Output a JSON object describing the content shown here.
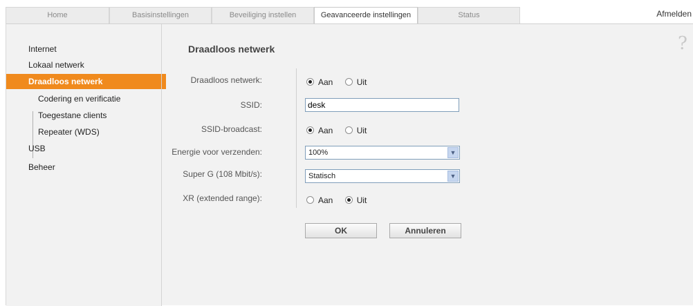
{
  "tabs": [
    {
      "label": "Home",
      "active": false
    },
    {
      "label": "Basisinstellingen",
      "active": false
    },
    {
      "label": "Beveiliging instellen",
      "active": false
    },
    {
      "label": "Geavanceerde instellingen",
      "active": true
    },
    {
      "label": "Status",
      "active": false
    }
  ],
  "logout_label": "Afmelden",
  "sidebar": {
    "items": [
      {
        "label": "Internet",
        "level": 0
      },
      {
        "label": "Lokaal netwerk",
        "level": 0
      },
      {
        "label": "Draadloos netwerk",
        "level": 0,
        "active": true
      },
      {
        "label": "Codering en verificatie",
        "level": 1
      },
      {
        "label": "Toegestane clients",
        "level": 1
      },
      {
        "label": "Repeater (WDS)",
        "level": 1
      },
      {
        "label": "USB",
        "level": 0
      },
      {
        "label": "Beheer",
        "level": 0
      }
    ]
  },
  "help_icon": "help-question-icon",
  "page_title": "Draadloos netwerk",
  "form": {
    "wireless": {
      "label": "Draadloos netwerk:",
      "options": [
        "Aan",
        "Uit"
      ],
      "selected": "Aan"
    },
    "ssid": {
      "label": "SSID:",
      "value": "desk"
    },
    "ssid_broadcast": {
      "label": "SSID-broadcast:",
      "options": [
        "Aan",
        "Uit"
      ],
      "selected": "Aan"
    },
    "tx_power": {
      "label": "Energie voor verzenden:",
      "value": "100%"
    },
    "super_g": {
      "label": "Super G (108 Mbit/s):",
      "value": "Statisch"
    },
    "xr": {
      "label": "XR (extended range):",
      "options": [
        "Aan",
        "Uit"
      ],
      "selected": "Uit"
    }
  },
  "buttons": {
    "ok": "OK",
    "cancel": "Annuleren"
  },
  "colors": {
    "accent": "#f08a1d",
    "background": "#f2f2f2"
  }
}
